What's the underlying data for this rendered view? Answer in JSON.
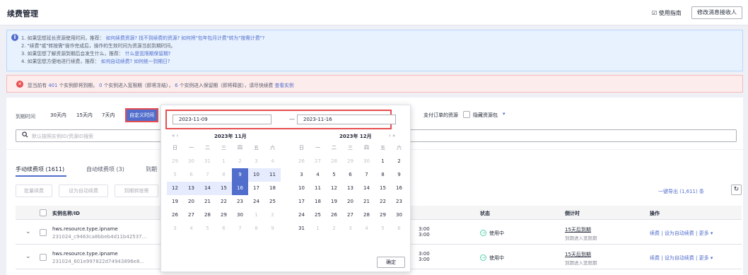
{
  "header": {
    "title": "续费管理",
    "guide": "使用指南",
    "modify_receiver": "修改消息接收人"
  },
  "tips": {
    "line1_a": "1. 如果您想延长资源使用时间，推荐：",
    "line1_link1": "如何续费资源?",
    "line1_link2": "找不到续费的资源?",
    "line1_link3": "如何将\"包年包月计费\"转为\"按需计费\"?",
    "line2": "2. \"续费\"或\"转按需\"操作完成后，操作的生效时间为资源当前到期时间。",
    "line3_a": "3. 如果您想了解资源到期后会发生什么，推荐：",
    "line3_link": "什么是宽限期保留期?",
    "line4_a": "4. 如果您想方便地进行续费，推荐：",
    "line4_link1": "如何自动续费?",
    "line4_link2": "如何统一到期日?"
  },
  "alert": {
    "p1": "您当前有",
    "count_expire": "401",
    "p2": "个实例即将到期，",
    "count_grace": "0",
    "p3": "个实例进入宽限期（即将冻结），",
    "count_retain": "6",
    "p4": "个实例进入保留期（即将释放），请尽快续费",
    "link": "查看实例"
  },
  "filters": {
    "expire_label": "到期时间",
    "options": [
      "30天内",
      "15天内",
      "7天内",
      "自定义时间"
    ],
    "pay_order": "支付订单的资源",
    "hide_label": "隐藏资源包",
    "search_placeholder": "默认按照实例ID/资源ID搜索"
  },
  "tabs": [
    "手动续费项 (1611)",
    "自动续费项 (3)",
    "到期"
  ],
  "toolbar": {
    "batch_renew": "批量续费",
    "set_auto": "设为自动续费",
    "set_ondemand": "到期转按需",
    "export": "一键导出 (1,611) 条"
  },
  "table": {
    "headers": [
      "实例名称/ID",
      "状态",
      "倒计时",
      "操作"
    ],
    "rows": [
      {
        "type": "hws.resource.type.ipname",
        "id": "231024_c9463ca8bbeb4d11b42537...",
        "time": "3:00\n3:00",
        "status": "使用中",
        "countdown": "15天后到期",
        "countdown_sub": "到期进入宽限期",
        "act1": "续费",
        "act2": "设为自动续费",
        "act3": "更多"
      },
      {
        "type": "hws.resource.type.ipname",
        "id": "231024_601e997822d74943896e8...",
        "time": "3:00\n3:00",
        "status": "使用中",
        "countdown": "15天后到期",
        "countdown_sub": "到期进入宽限期",
        "act1": "续费",
        "act2": "设为自动续费",
        "act3": "更多"
      }
    ]
  },
  "picker": {
    "start": "2023-11-09",
    "end": "2023-11-16",
    "left_title": "2023年 11月",
    "right_title": "2023年 12月",
    "weekdays": [
      "日",
      "一",
      "二",
      "三",
      "四",
      "五",
      "六"
    ],
    "left_days": [
      [
        "29",
        "d"
      ],
      [
        "30",
        "d"
      ],
      [
        "31",
        "d"
      ],
      [
        "1",
        "d"
      ],
      [
        "2",
        "d"
      ],
      [
        "3",
        "d"
      ],
      [
        "4",
        "d"
      ],
      [
        "5",
        "d"
      ],
      [
        "6",
        "d"
      ],
      [
        "7",
        "d"
      ],
      [
        "8",
        "d"
      ],
      [
        "9",
        "s"
      ],
      [
        "10",
        "r"
      ],
      [
        "11",
        "r"
      ],
      [
        "12",
        "r"
      ],
      [
        "13",
        "r"
      ],
      [
        "14",
        "r"
      ],
      [
        "15",
        "r"
      ],
      [
        "16",
        "s"
      ],
      [
        "17",
        ""
      ],
      [
        "18",
        ""
      ],
      [
        "19",
        ""
      ],
      [
        "20",
        ""
      ],
      [
        "21",
        ""
      ],
      [
        "22",
        ""
      ],
      [
        "23",
        ""
      ],
      [
        "24",
        ""
      ],
      [
        "25",
        ""
      ],
      [
        "26",
        ""
      ],
      [
        "27",
        ""
      ],
      [
        "28",
        ""
      ],
      [
        "29",
        ""
      ],
      [
        "30",
        ""
      ],
      [
        "1",
        "d"
      ],
      [
        "2",
        "d"
      ],
      [
        "3",
        "d"
      ],
      [
        "4",
        "d"
      ],
      [
        "5",
        "d"
      ],
      [
        "6",
        "d"
      ],
      [
        "7",
        "d"
      ],
      [
        "8",
        "d"
      ],
      [
        "9",
        "d"
      ]
    ],
    "right_days": [
      [
        "26",
        "d"
      ],
      [
        "27",
        "d"
      ],
      [
        "28",
        "d"
      ],
      [
        "29",
        "d"
      ],
      [
        "30",
        "d"
      ],
      [
        "1",
        ""
      ],
      [
        "2",
        ""
      ],
      [
        "3",
        ""
      ],
      [
        "4",
        ""
      ],
      [
        "5",
        ""
      ],
      [
        "6",
        ""
      ],
      [
        "7",
        ""
      ],
      [
        "8",
        ""
      ],
      [
        "9",
        ""
      ],
      [
        "10",
        ""
      ],
      [
        "11",
        ""
      ],
      [
        "12",
        ""
      ],
      [
        "13",
        ""
      ],
      [
        "14",
        ""
      ],
      [
        "15",
        ""
      ],
      [
        "16",
        ""
      ],
      [
        "17",
        ""
      ],
      [
        "18",
        ""
      ],
      [
        "19",
        ""
      ],
      [
        "20",
        ""
      ],
      [
        "21",
        ""
      ],
      [
        "22",
        ""
      ],
      [
        "23",
        ""
      ],
      [
        "24",
        ""
      ],
      [
        "25",
        ""
      ],
      [
        "26",
        ""
      ],
      [
        "27",
        ""
      ],
      [
        "28",
        ""
      ],
      [
        "29",
        ""
      ],
      [
        "30",
        ""
      ],
      [
        "31",
        ""
      ],
      [
        "1",
        "d"
      ],
      [
        "2",
        "d"
      ],
      [
        "3",
        "d"
      ],
      [
        "4",
        "d"
      ],
      [
        "5",
        "d"
      ],
      [
        "6",
        "d"
      ]
    ],
    "ok": "确定"
  }
}
